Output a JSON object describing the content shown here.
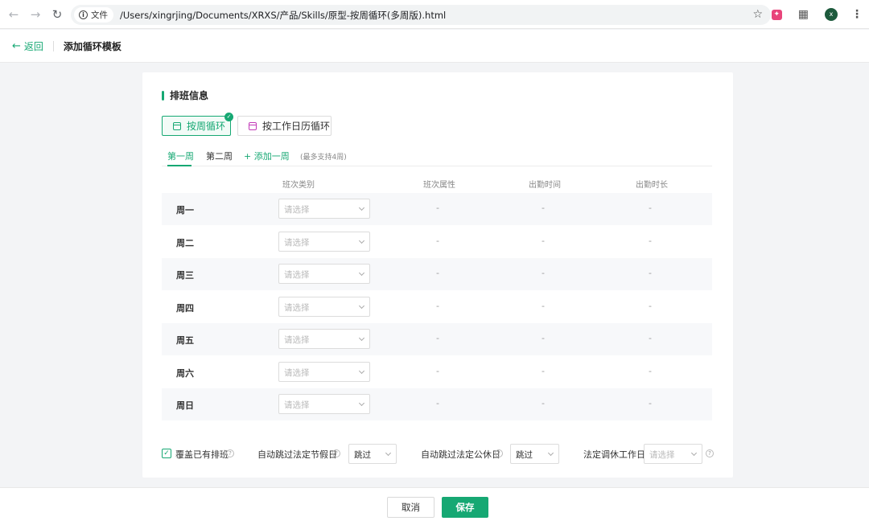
{
  "browser": {
    "file_chip": "文件",
    "url": "/Users/xingrjing/Documents/XRXS/产品/Skills/原型-按周循环(多周版).html",
    "avatar_letter": "x"
  },
  "header": {
    "back_label": "返回",
    "title": "添加循环模板"
  },
  "section": {
    "title": "排班信息"
  },
  "modes": [
    {
      "label": "按周循环",
      "selected": true
    },
    {
      "label": "按工作日历循环",
      "selected": false
    }
  ],
  "tabs": {
    "items": [
      "第一周",
      "第二周"
    ],
    "active_index": 0,
    "add_label": "+ 添加一周",
    "hint": "(最多支持4周)"
  },
  "table": {
    "columns": [
      "班次类别",
      "班次属性",
      "出勤时间",
      "出勤时长"
    ],
    "select_placeholder": "请选择",
    "empty_value": "-",
    "days": [
      "周一",
      "周二",
      "周三",
      "周四",
      "周五",
      "周六",
      "周日"
    ]
  },
  "options": {
    "overwrite_label": "覆盖已有排班",
    "overwrite_checked": true,
    "skip_holiday_label": "自动跳过法定节假日",
    "skip_holiday_value": "跳过",
    "skip_rest_label": "自动跳过法定公休日",
    "skip_rest_value": "跳过",
    "adjust_workday_label": "法定调休工作日",
    "adjust_workday_placeholder": "请选择"
  },
  "footer": {
    "cancel_label": "取消",
    "save_label": "保存"
  },
  "colors": {
    "accent": "#16a873"
  }
}
